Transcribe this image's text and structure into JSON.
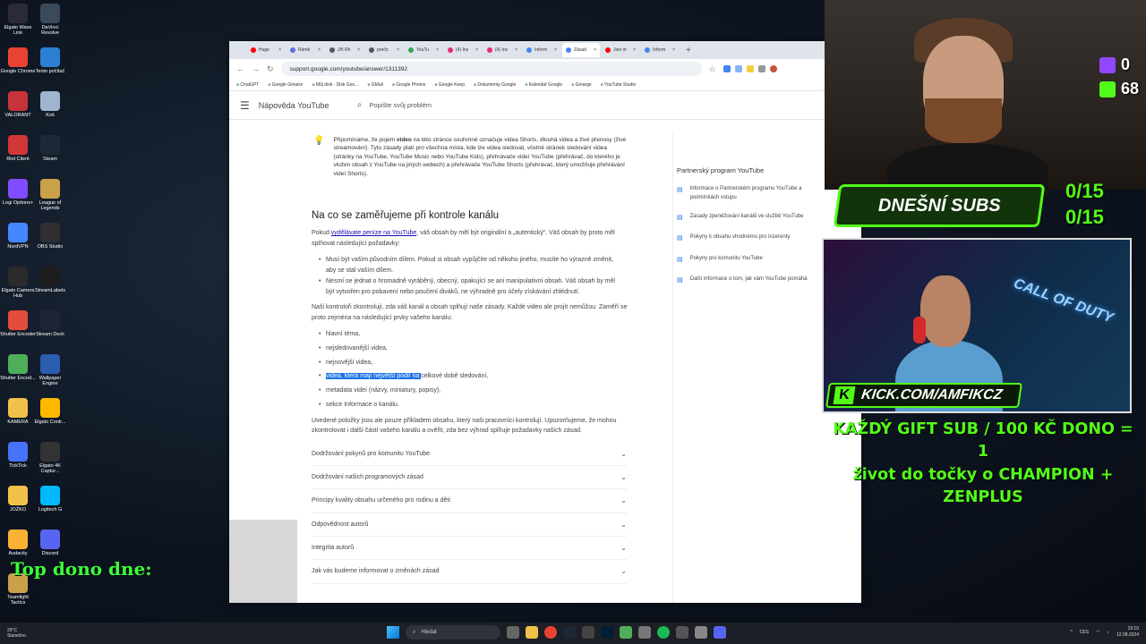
{
  "desktop": {
    "icons": [
      {
        "label": "Elgato Wave Link",
        "color": "#2a2a3a"
      },
      {
        "label": "DaVinci Resolve",
        "color": "#3a4a5a"
      },
      {
        "label": "Google Chrome",
        "color": "#e94235"
      },
      {
        "label": "Tento počítač",
        "color": "#2d7fd3"
      },
      {
        "label": "VALORANT",
        "color": "#c7333b"
      },
      {
        "label": "Koš",
        "color": "#9fb5cf"
      },
      {
        "label": "Riot Client",
        "color": "#d13639"
      },
      {
        "label": "Steam",
        "color": "#1b2838"
      },
      {
        "label": "Logi Options+",
        "color": "#814cff"
      },
      {
        "label": "League of Legends",
        "color": "#c8a14a"
      },
      {
        "label": "NordVPN",
        "color": "#4687ff"
      },
      {
        "label": "OBS Studio",
        "color": "#302e31"
      },
      {
        "label": "Elgato Camera Hub",
        "color": "#2b2b2b"
      },
      {
        "label": "StreamLabels",
        "color": "#1d1d1d"
      },
      {
        "label": "Shutter Encoder",
        "color": "#e24d3c"
      },
      {
        "label": "Stream Deck",
        "color": "#1e2435"
      },
      {
        "label": "Shutter Encod...",
        "color": "#4fae5a"
      },
      {
        "label": "Wallpaper Engine",
        "color": "#2a5db0"
      },
      {
        "label": "KAMERA",
        "color": "#f0c24a"
      },
      {
        "label": "Elgato Contr...",
        "color": "#ffb800"
      },
      {
        "label": "TickTick",
        "color": "#4772fa"
      },
      {
        "label": "Elgato 4K Captur...",
        "color": "#333"
      },
      {
        "label": "JOŽKO",
        "color": "#f0c24a"
      },
      {
        "label": "Logitech G",
        "color": "#00b8fc"
      },
      {
        "label": "Audacity",
        "color": "#f9b233"
      },
      {
        "label": "Discord",
        "color": "#5865f2"
      },
      {
        "label": "Teamfight Tactics",
        "color": "#c8a14a"
      }
    ],
    "top_dono_label": "Top dono dne:"
  },
  "browser": {
    "tabs": [
      {
        "label": "Huge",
        "color": "#ff0000"
      },
      {
        "label": "Rámě",
        "color": "#5b6ee1"
      },
      {
        "label": "Jiří Rh",
        "color": "#555"
      },
      {
        "label": "prečo",
        "color": "#555"
      },
      {
        "label": "YouTu",
        "color": "#34a853"
      },
      {
        "label": "(4) Ins",
        "color": "#e1306c"
      },
      {
        "label": "(4) Ins",
        "color": "#e1306c"
      },
      {
        "label": "Inform",
        "color": "#4285f4"
      },
      {
        "label": "Zásad",
        "color": "#4285f4"
      },
      {
        "label": "Join m",
        "color": "#ff0000"
      },
      {
        "label": "Inform",
        "color": "#4285f4"
      }
    ],
    "active_tab_index": 8,
    "new_tab": "+",
    "url": "support.google.com/youtube/answer/1311392",
    "bookmarks": [
      "ChatGPT",
      "Google Gmaisn",
      "Můj disk - Disk Goo...",
      "GMail",
      "Google Photos",
      "Google Keep",
      "Dokumenty Google",
      "Kalendář Google",
      "Gmarge",
      "YouTube Studio"
    ]
  },
  "help": {
    "title": "Nápověda YouTube",
    "search_placeholder": "Popište svůj problém"
  },
  "article": {
    "note_prefix": "Připomínáme, že pojem ",
    "note_bold": "video",
    "note_rest": " na této stránce souhrnně označuje videa Shorts, dlouhá videa a živé přenosy (živé streamování). Tyto zásady platí pro všechna místa, kde lze videa sledovat, včetně stránek sledování videa (stránky na YouTube, YouTube Music nebo YouTube Kids), přehrávače videí YouTube (přehrávač, do kterého je vložen obsah z YouTube na jiných webech) a přehrávače YouTube Shorts (přehrávač, který umožňuje přehrávání videí Shorts).",
    "heading": "Na co se zaměřujeme při kontrole kanálu",
    "intro_prefix": "Pokud ",
    "intro_link": "vydělávate peníze na YouTube",
    "intro_rest": ", váš obsah by měl být originální a „autentický“. Váš obsah by proto měl splňovat následující požadavky:",
    "requirements": [
      "Musí být vaším původním dílem. Pokud si obsah vypůjčíte od někoho jiného, musíte ho výrazně změnit, aby se stal vaším dílem.",
      "Nesmí se jednat o hromadně vyráběný, obecný, opakující se ani manipulativní obsah. Váš obsah by měl být vytvořen pro pobavení nebo poučení diváků, ne výhradně pro účely získávání zhlédnutí."
    ],
    "check_text": "Naši kontroloři zkontrolují, zda váš kanál a obsah splňují naše zásady. Každé video ale projít nemůžou. Zaměří se proto zejména na následující prvky vašeho kanálu:",
    "elements": [
      "hlavní téma,",
      "nejsledovanější videa,",
      "nejnovější videa,",
      "celkové době sledování,",
      "metadata videí (názvy, miniatury, popisy),",
      "sekce Informace o kanálu."
    ],
    "highlight_text": "videa, která mají největší podíl na ",
    "examples_text": "Uvedené položky jsou ale pouze příklad­em obsahu, který naši pracovníci kontrolují. Upozorňujeme, že mohou zkontrolovat i další části vašeho kanálu a ověřit, zda bez výhrad splňuje požadavky našich zásad.",
    "accordions": [
      "Dodržování pokynů pro komunitu YouTube",
      "Dodržování našich programových zásad",
      "Principy kvality obsahu určeného pro rodinu a děti",
      "Odpovědnost autorů",
      "Integrita autorů",
      "Jak vás budeme informovat o změnách zásad"
    ]
  },
  "sidebar": {
    "title": "Partnerský program YouTube",
    "items": [
      "Informace o Partnerském programu YouTube a podmínkách vstupu",
      "Zásady zpeněžování kanálů ve službě YouTube",
      "Pokyny k obsahu vhodnému pro inzerenty",
      "Pokyny pro komunitu YouTube",
      "Další informace o tom, jak vám YouTube pomáhá"
    ]
  },
  "stream": {
    "twitch_count": "0",
    "kick_count": "68",
    "subs_label": "DNEŠNÍ SUBS",
    "subs_1": "0/15",
    "subs_2": "0/15",
    "kick_url": "KICK.COM/AMFIKCZ",
    "kick_logo": "K",
    "cod_text": "CALL OF DUTY",
    "gift_line1": "KAŽDÝ GIFT SUB / 100 KČ DONO = 1",
    "gift_line2": "život do točky o CHAMPION + ZENPLUS",
    "twitch_color": "#9146ff",
    "kick_color": "#53fc18"
  },
  "taskbar": {
    "weather_temp": "25°C",
    "weather_desc": "Slunečno",
    "search_placeholder": "Hledat",
    "language": "CES",
    "time": "19:10",
    "date": "12.08.2024"
  }
}
